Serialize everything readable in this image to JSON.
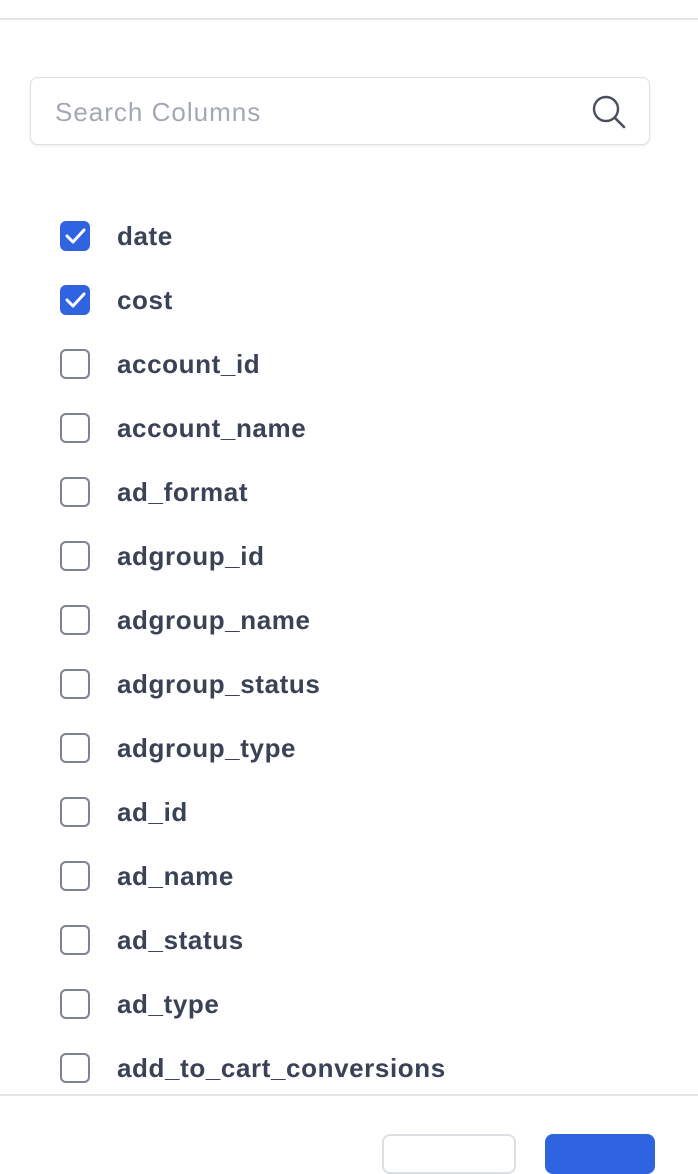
{
  "search": {
    "placeholder": "Search Columns",
    "value": ""
  },
  "columns": [
    {
      "label": "date",
      "checked": true
    },
    {
      "label": "cost",
      "checked": true
    },
    {
      "label": "account_id",
      "checked": false
    },
    {
      "label": "account_name",
      "checked": false
    },
    {
      "label": "ad_format",
      "checked": false
    },
    {
      "label": "adgroup_id",
      "checked": false
    },
    {
      "label": "adgroup_name",
      "checked": false
    },
    {
      "label": "adgroup_status",
      "checked": false
    },
    {
      "label": "adgroup_type",
      "checked": false
    },
    {
      "label": "ad_id",
      "checked": false
    },
    {
      "label": "ad_name",
      "checked": false
    },
    {
      "label": "ad_status",
      "checked": false
    },
    {
      "label": "ad_type",
      "checked": false
    },
    {
      "label": "add_to_cart_conversions",
      "checked": false
    }
  ],
  "colors": {
    "accent": "#2f63e0",
    "text": "#3a4256",
    "placeholder": "#a3a8b3",
    "checkbox_border": "#7d8290"
  }
}
